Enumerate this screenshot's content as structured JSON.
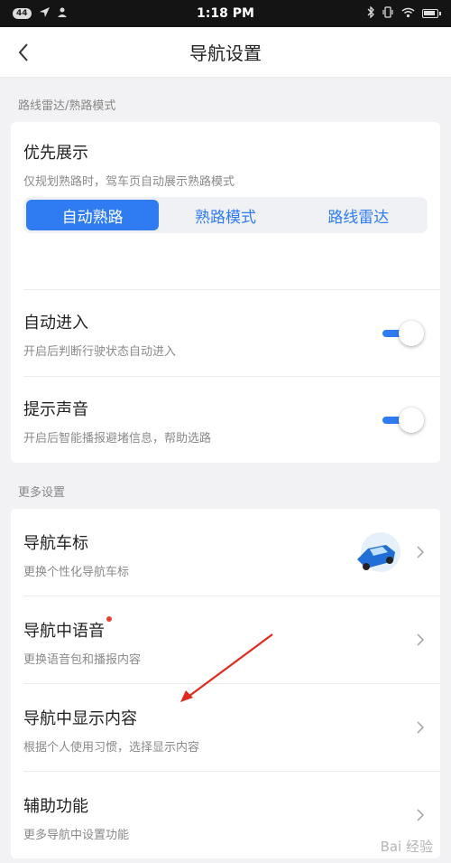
{
  "status_bar": {
    "badge": "44",
    "time": "1:18 PM",
    "left_icons": [
      "navigation-arrow-icon",
      "person-icon"
    ],
    "right_icons": [
      "bluetooth-icon",
      "vibrate-icon",
      "wifi-icon",
      "battery-icon"
    ]
  },
  "header": {
    "title": "导航设置",
    "back_icon": "chevron-left-icon"
  },
  "section_1": {
    "title": "路线雷达/熟路模式",
    "priority": {
      "title": "优先展示",
      "subtitle": "仅规划熟路时，驾车页自动展示熟路模式",
      "options": [
        "自动熟路",
        "熟路模式",
        "路线雷达"
      ],
      "selected": "自动熟路"
    },
    "auto_enter": {
      "title": "自动进入",
      "subtitle": "开启后判断行驶状态自动进入",
      "enabled": true
    },
    "sound": {
      "title": "提示声音",
      "subtitle": "开启后智能播报避堵信息，帮助选路",
      "enabled": true
    }
  },
  "section_2": {
    "title": "更多设置",
    "items": [
      {
        "title": "导航车标",
        "subtitle": "更换个性化导航车标",
        "icon": "car-icon"
      },
      {
        "title": "导航中语音",
        "subtitle": "更换语音包和播报内容",
        "new_dot": true
      },
      {
        "title": "导航中显示内容",
        "subtitle": "根据个人使用习惯，选择显示内容"
      },
      {
        "title": "辅助功能",
        "subtitle": "更多导航中设置功能"
      }
    ]
  },
  "colors": {
    "accent": "#2f7cf2",
    "annotation_arrow": "#e02a1d",
    "new_dot": "#e8412e"
  },
  "watermark": "Bai 经验"
}
